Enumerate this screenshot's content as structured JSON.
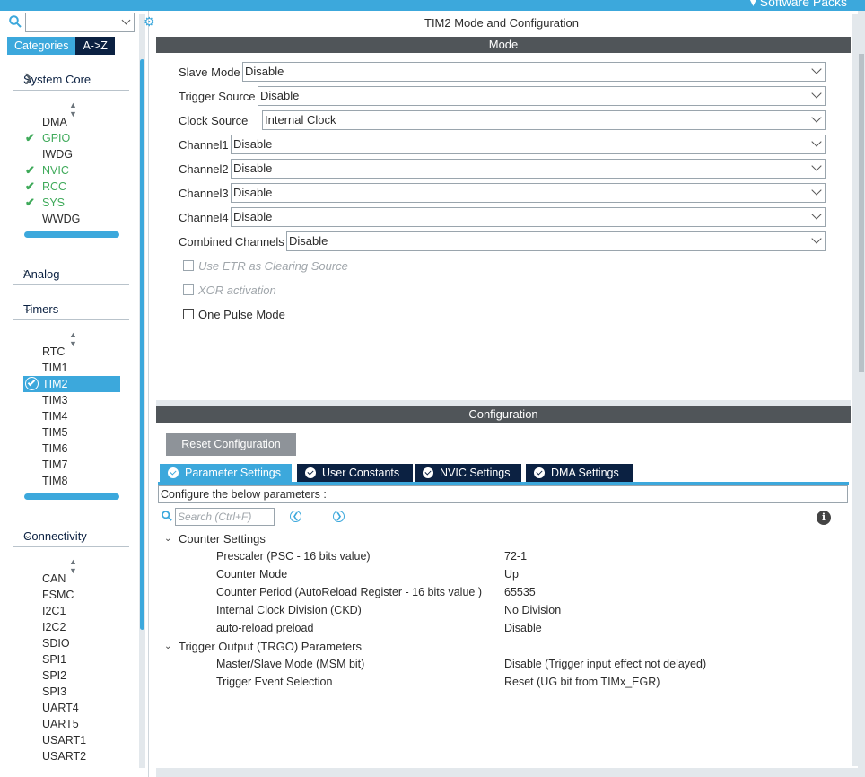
{
  "topbar": {
    "label": "Software Packs"
  },
  "sidebar": {
    "tabs": {
      "categories": "Categories",
      "az": "A->Z"
    },
    "system_core": {
      "title": "System Core",
      "items": [
        "DMA",
        "GPIO",
        "IWDG",
        "NVIC",
        "RCC",
        "SYS",
        "WWDG"
      ]
    },
    "analog": {
      "title": "Analog"
    },
    "timers": {
      "title": "Timers",
      "items": [
        "RTC",
        "TIM1",
        "TIM2",
        "TIM3",
        "TIM4",
        "TIM5",
        "TIM6",
        "TIM7",
        "TIM8"
      ]
    },
    "connectivity": {
      "title": "Connectivity",
      "items": [
        "CAN",
        "FSMC",
        "I2C1",
        "I2C2",
        "SDIO",
        "SPI1",
        "SPI2",
        "SPI3",
        "UART4",
        "UART5",
        "USART1",
        "USART2"
      ]
    }
  },
  "main": {
    "title": "TIM2 Mode and Configuration",
    "mode_header": "Mode",
    "fields": [
      {
        "label": "Slave Mode",
        "value": "Disable"
      },
      {
        "label": "Trigger Source",
        "value": "Disable"
      },
      {
        "label": "Clock Source",
        "value": "Internal Clock"
      },
      {
        "label": "Channel1",
        "value": "Disable"
      },
      {
        "label": "Channel2",
        "value": "Disable"
      },
      {
        "label": "Channel3",
        "value": "Disable"
      },
      {
        "label": "Channel4",
        "value": "Disable"
      },
      {
        "label": "Combined Channels",
        "value": "Disable"
      }
    ],
    "checkboxes": [
      "Use ETR as Clearing Source",
      "XOR activation",
      "One Pulse Mode"
    ],
    "config_header": "Configuration",
    "reset_button": "Reset Configuration",
    "tabs": [
      "Parameter Settings",
      "User Constants",
      "NVIC Settings",
      "DMA Settings"
    ],
    "configure_text": "Configure the below parameters :",
    "search_placeholder": "Search (Ctrl+F)",
    "groups": [
      {
        "title": "Counter Settings",
        "params": [
          {
            "name": "Prescaler (PSC - 16 bits value)",
            "value": "72-1"
          },
          {
            "name": "Counter Mode",
            "value": "Up"
          },
          {
            "name": "Counter Period (AutoReload Register - 16 bits value )",
            "value": "65535"
          },
          {
            "name": "Internal Clock Division (CKD)",
            "value": "No Division"
          },
          {
            "name": "auto-reload preload",
            "value": "Disable"
          }
        ]
      },
      {
        "title": "Trigger Output (TRGO) Parameters",
        "params": [
          {
            "name": "Master/Slave Mode (MSM bit)",
            "value": "Disable (Trigger input effect not delayed)"
          },
          {
            "name": "Trigger Event Selection",
            "value": "Reset (UG bit from TIMx_EGR)"
          }
        ]
      }
    ]
  }
}
